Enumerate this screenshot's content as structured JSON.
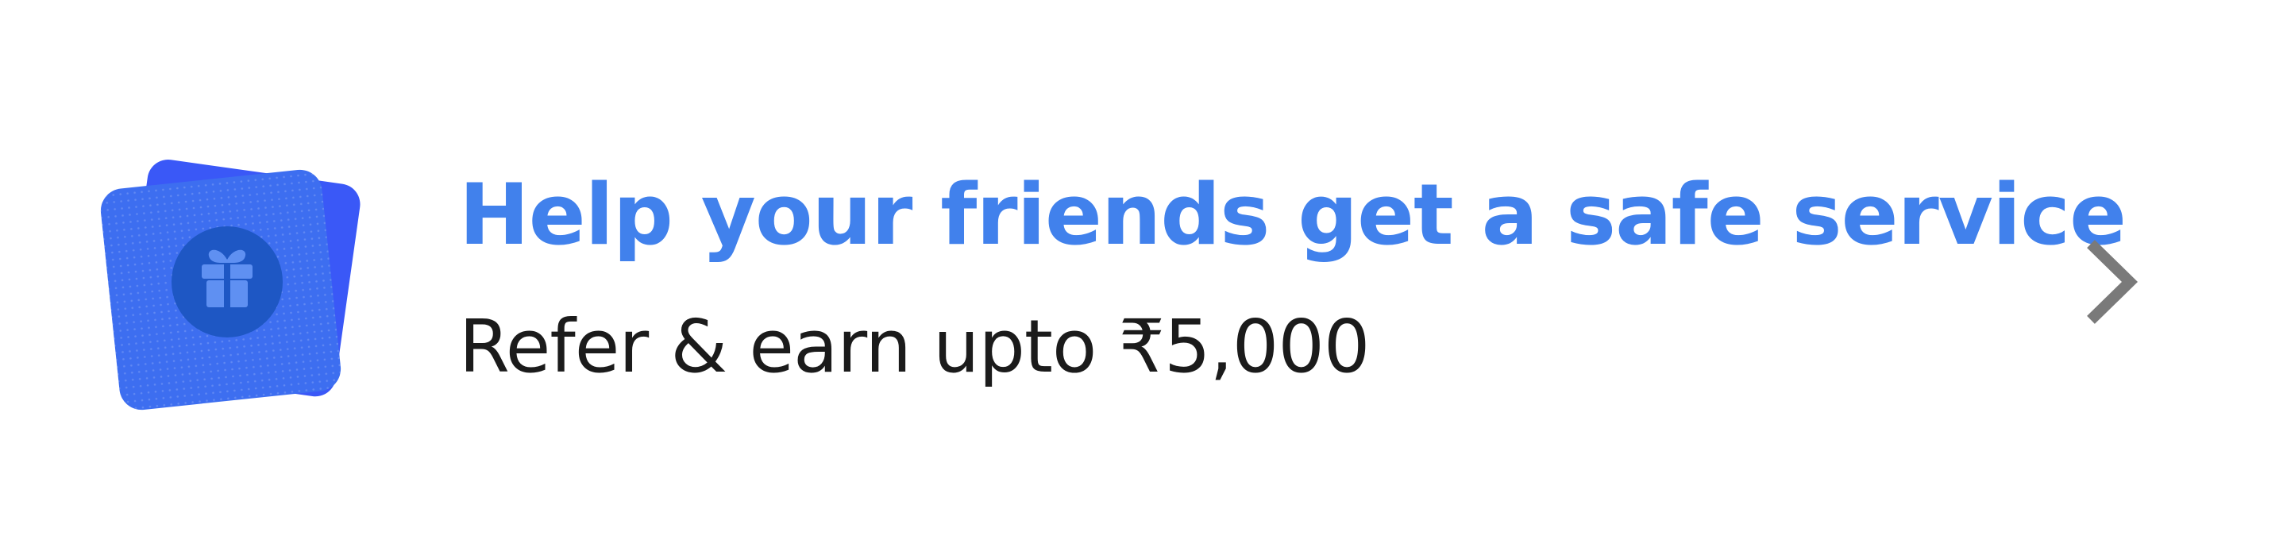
{
  "referral": {
    "headline": "Help your friends get a safe service",
    "subtext": "Refer & earn upto ₹5,000",
    "icon": "gift-icon",
    "chevron_icon": "chevron-right-icon"
  },
  "colors": {
    "headline": "#4181ec",
    "subtext": "#1b1b1b",
    "card_back": "#3a58f7",
    "card_front": "#3d6ef0",
    "badge": "#1e57c4",
    "chevron": "#7a7a7a"
  }
}
